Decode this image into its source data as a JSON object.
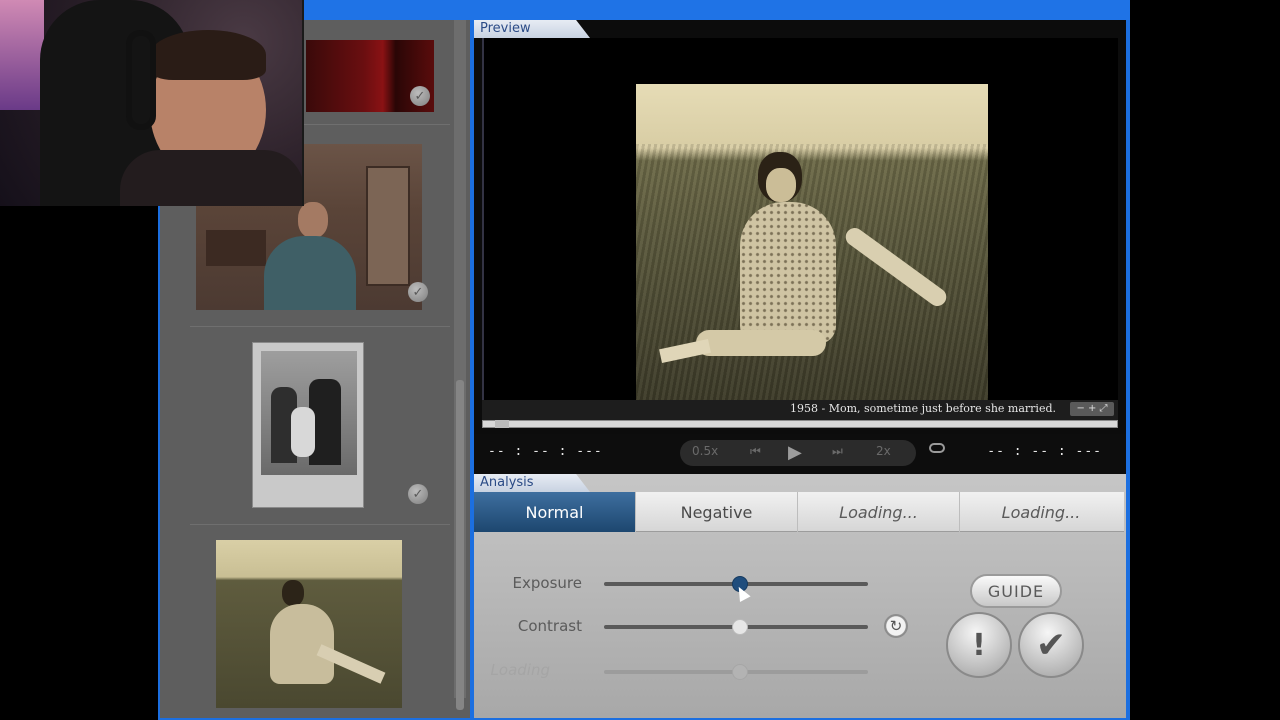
{
  "preview": {
    "tab_label": "Preview",
    "caption": "1958 - Mom, sometime just before she married.",
    "zoom_control": "− + ⤢",
    "progress_fraction": 0.02
  },
  "transport": {
    "time_left": "-- : -- : ---",
    "time_right": "-- : -- : ---",
    "speed_slow": "0.5x",
    "step_back_icon": "step-back-icon",
    "play_icon": "play-icon",
    "step_forward_icon": "step-forward-icon",
    "speed_fast": "2x",
    "loop_icon": "loop-icon"
  },
  "analysis": {
    "tab_label": "Analysis",
    "modes": [
      {
        "label": "Normal",
        "active": true
      },
      {
        "label": "Negative",
        "active": false
      },
      {
        "label": "Loading...",
        "active": false
      },
      {
        "label": "Loading...",
        "active": false
      }
    ],
    "adjustments": [
      {
        "label": "Exposure",
        "value": 0.5,
        "enabled": true
      },
      {
        "label": "Contrast",
        "value": 0.5,
        "enabled": true
      },
      {
        "label": "Loading",
        "value": 0.5,
        "enabled": false
      }
    ],
    "guide_label": "GUIDE",
    "alert_glyph": "!",
    "confirm_glyph": "✔"
  },
  "library": {
    "items": [
      {
        "name": "red-room-photo",
        "checked": true
      },
      {
        "name": "woman-kitchen-photo",
        "checked": true
      },
      {
        "name": "family-portrait-photo",
        "checked": true
      },
      {
        "name": "woman-field-photo",
        "selected": true
      }
    ]
  },
  "colors": {
    "window_frame": "#1c6fe0",
    "active_tab": "#1d476f",
    "panel_bg": "#5e5e5e"
  }
}
